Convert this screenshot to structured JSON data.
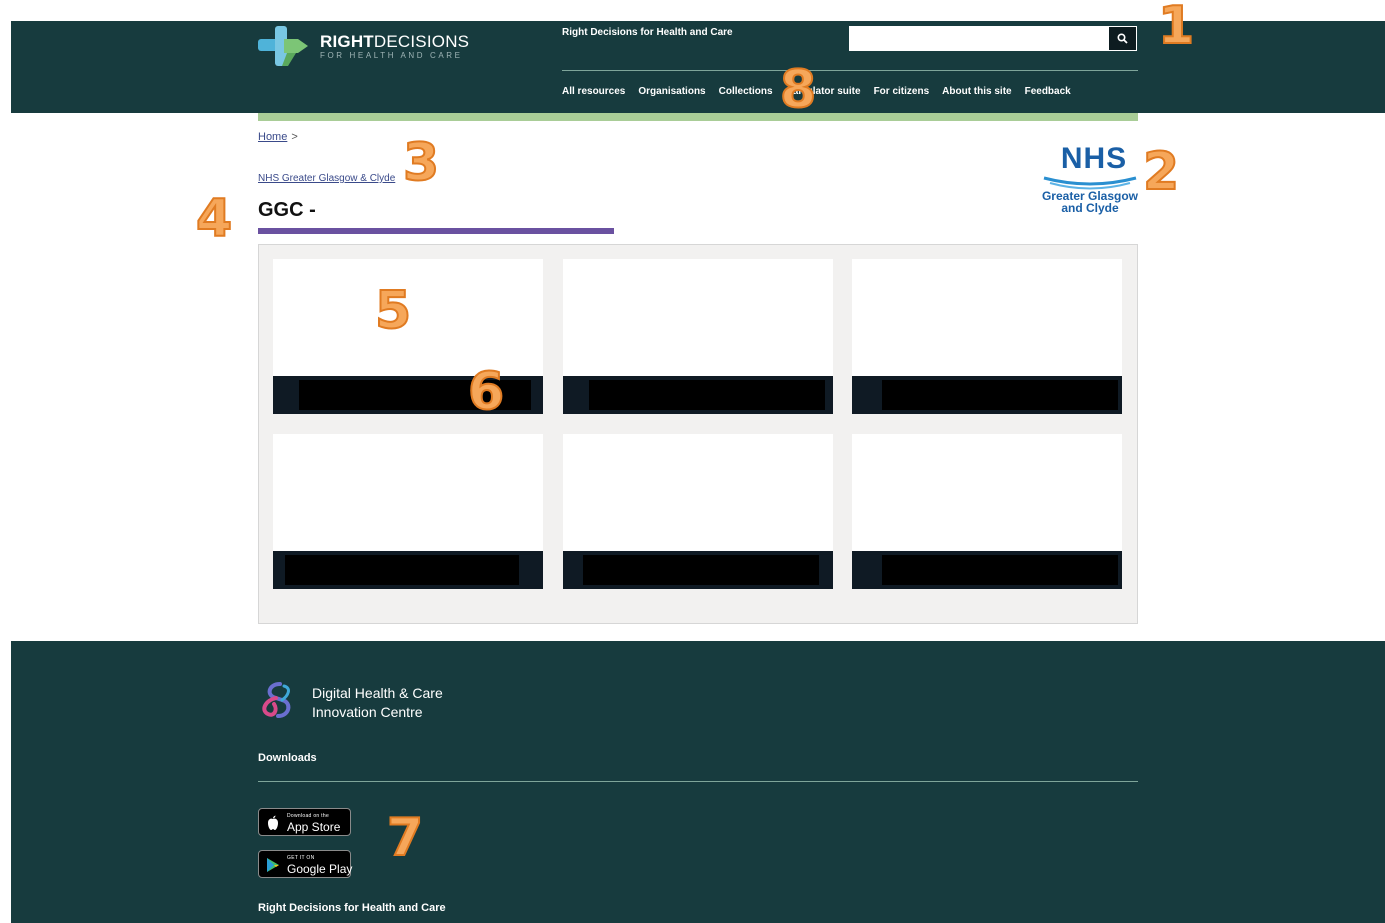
{
  "header": {
    "logo_bold": "RIGHT",
    "logo_rest": "DECISIONS",
    "logo_sub": "FOR HEALTH AND CARE",
    "site_title": "Right Decisions for Health and Care",
    "search": {
      "value": "",
      "placeholder": ""
    },
    "nav": [
      {
        "label": "All resources"
      },
      {
        "label": "Organisations"
      },
      {
        "label": "Collections"
      },
      {
        "label": "Calculator suite"
      },
      {
        "label": "For citizens"
      },
      {
        "label": "About this site"
      },
      {
        "label": "Feedback"
      }
    ],
    "icons": {
      "search": "search-icon"
    }
  },
  "breadcrumb": {
    "home": "Home",
    "separator": ">",
    "org_link": "NHS Greater Glasgow & Clyde"
  },
  "page": {
    "title": "GGC -"
  },
  "nhs_logo": {
    "letters": "NHS",
    "line1": "Greater Glasgow",
    "line2": "and Clyde"
  },
  "tiles": [
    {
      "label": ""
    },
    {
      "label": ""
    },
    {
      "label": ""
    },
    {
      "label": ""
    },
    {
      "label": ""
    },
    {
      "label": ""
    }
  ],
  "footer": {
    "org_line1": "Digital Health & Care",
    "org_line2": "Innovation Centre",
    "downloads": "Downloads",
    "app_store_small": "Download on the",
    "app_store_big": "App Store",
    "google_play_small": "GET IT ON",
    "google_play_big": "Google Play",
    "bottom_title": "Right Decisions for Health and Care"
  },
  "annotations": [
    "1",
    "2",
    "3",
    "4",
    "5",
    "6",
    "7",
    "8"
  ],
  "colors": {
    "header_bg": "#173b3e",
    "accent_green": "#a9cd97",
    "title_underline": "#6a51a0",
    "nhs_blue": "#1a5fa6",
    "annotation_orange": "#f6a75a"
  }
}
